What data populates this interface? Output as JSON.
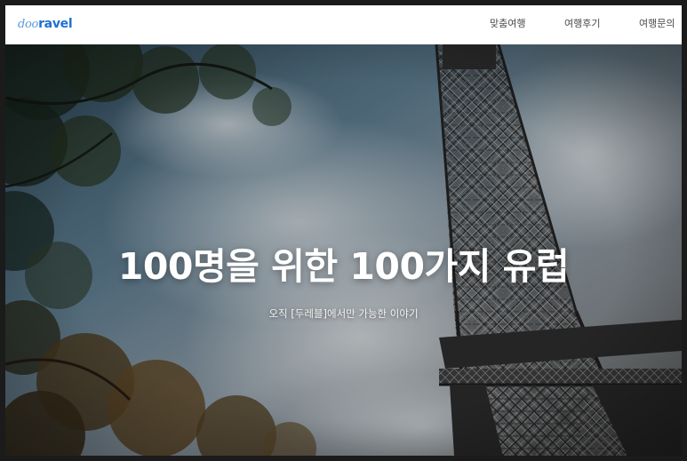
{
  "header": {
    "logo": {
      "part_a": "doo",
      "part_b": "ravel"
    },
    "nav": [
      {
        "label": "맞춤여행"
      },
      {
        "label": "여행후기"
      },
      {
        "label": "여행문의"
      }
    ]
  },
  "hero": {
    "title": "100명을 위한 100가지 유럽",
    "subtitle": "오직 [두레블]에서만 가능한 이야기",
    "background": "eiffel-tower-sky-photo"
  },
  "colors": {
    "brand": "#1f6fd0",
    "brand_light": "#5a9bd6",
    "nav_text": "#4a4a4a",
    "hero_text": "#ffffff"
  }
}
